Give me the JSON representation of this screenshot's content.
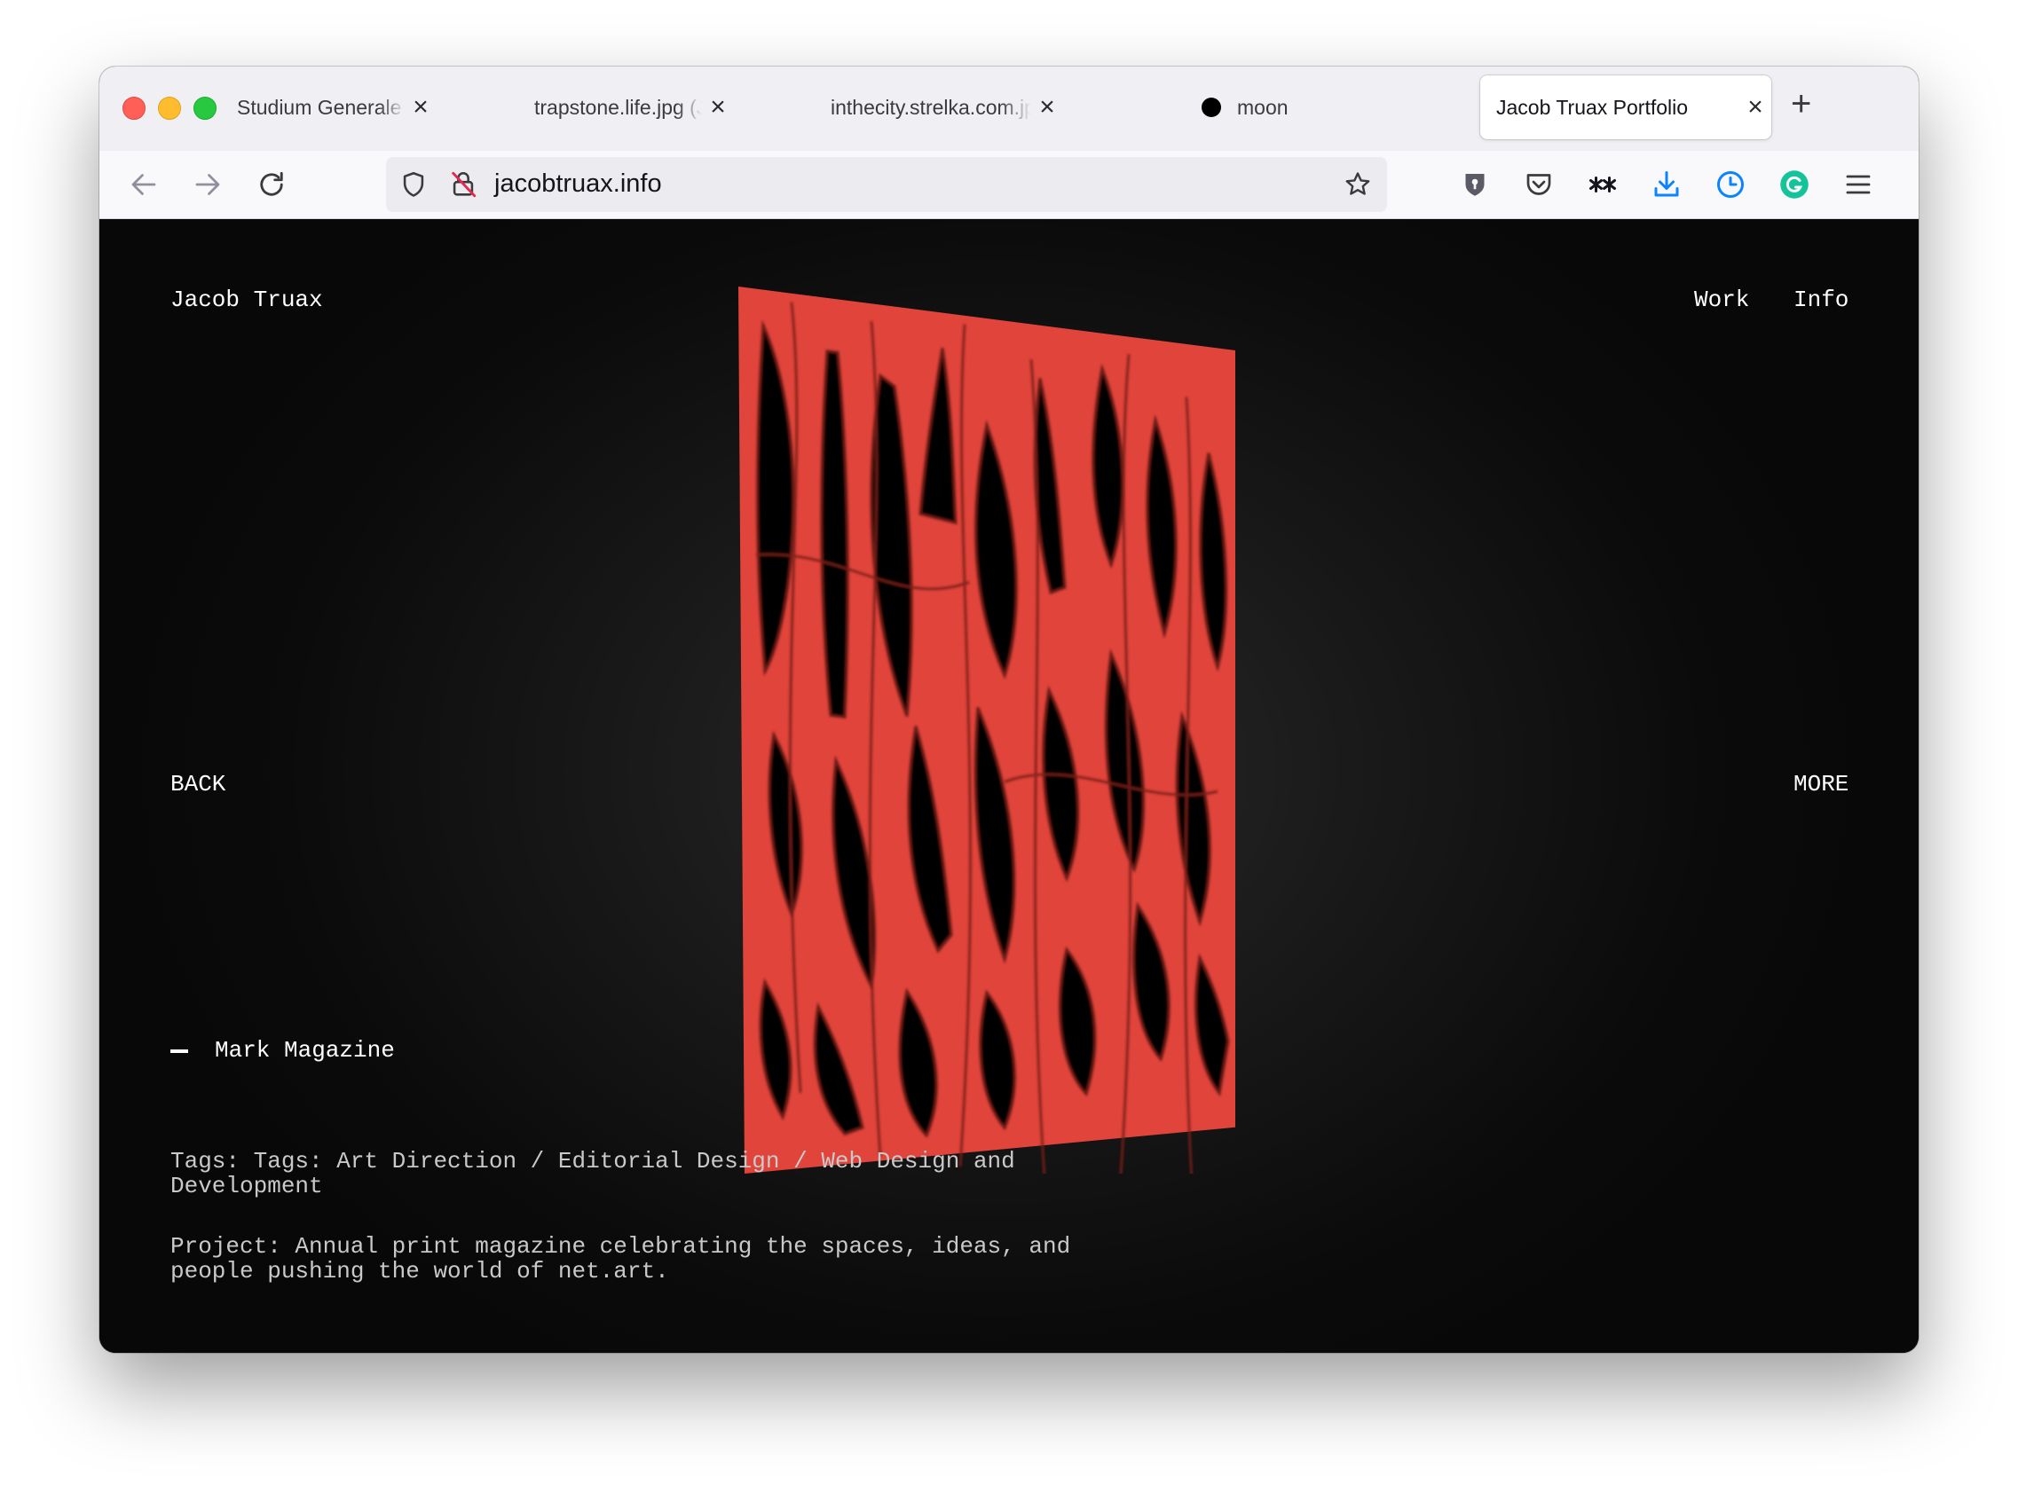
{
  "browser": {
    "tabs": [
      {
        "title": "Studium Generale | Take a",
        "close": "×"
      },
      {
        "title": "trapstone.life.jpg (JPEG I",
        "close": "×"
      },
      {
        "title": "inthecity.strelka.com.jpg",
        "close": "×"
      },
      {
        "title": "moon",
        "close": "×"
      },
      {
        "title": "Jacob Truax Portfolio",
        "close": "×"
      }
    ],
    "new_tab": "+",
    "url": "jacobtruax.info",
    "icons": [
      "back-icon",
      "forward-icon",
      "reload-icon",
      "tracking-shield-icon",
      "insecure-lock-icon",
      "bookmark-star-icon",
      "password-manager-icon",
      "pocket-icon",
      "extension-icon",
      "download-icon",
      "history-icon",
      "grammarly-icon",
      "menu-icon"
    ],
    "colors": {
      "download": "#0a84ff",
      "history": "#0a84ff",
      "grammarly": "#15c39a"
    }
  },
  "site": {
    "title": "Jacob Truax",
    "nav": {
      "work": "Work",
      "info": "Info"
    },
    "back": "BACK",
    "more": "MORE",
    "project": {
      "title": "Mark Magazine",
      "tags": "Tags: Tags: Art Direction / Editorial Design / Web Design and Development",
      "description": "Project: Annual print magazine celebrating the spaces, ideas, and people pushing the world of net.art."
    },
    "artwork_colors": {
      "red": "#e0443b",
      "black": "#000000"
    }
  }
}
